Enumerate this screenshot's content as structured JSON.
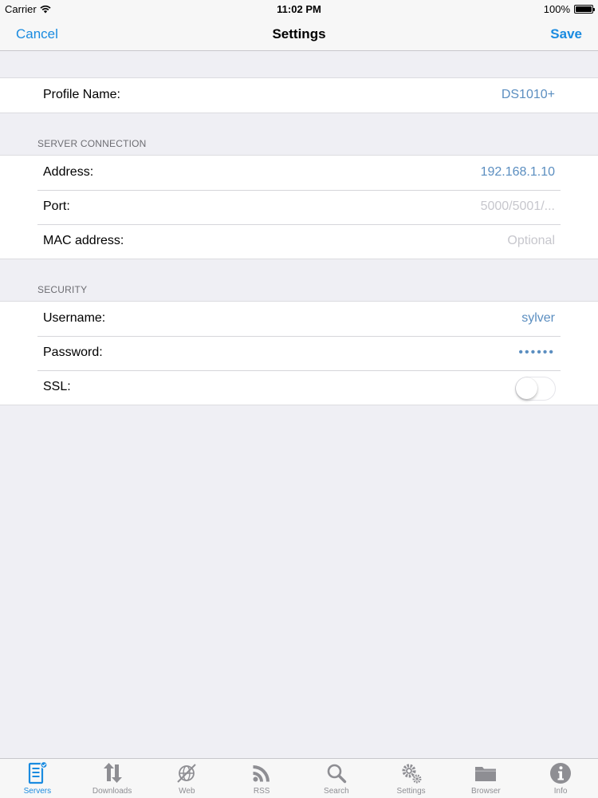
{
  "status_bar": {
    "carrier": "Carrier",
    "time": "11:02 PM",
    "battery": "100%"
  },
  "nav": {
    "cancel": "Cancel",
    "title": "Settings",
    "save": "Save"
  },
  "profile": {
    "label": "Profile Name:",
    "value": "DS1010+"
  },
  "server_connection": {
    "header": "SERVER CONNECTION",
    "address_label": "Address:",
    "address_value": "192.168.1.10",
    "port_label": "Port:",
    "port_placeholder": "5000/5001/...",
    "mac_label": "MAC address:",
    "mac_placeholder": "Optional"
  },
  "security": {
    "header": "SECURITY",
    "username_label": "Username:",
    "username_value": "sylver",
    "password_label": "Password:",
    "password_value": "••••••",
    "ssl_label": "SSL:",
    "ssl_on": false
  },
  "tabs": [
    {
      "label": "Servers",
      "icon": "servers-icon",
      "active": true
    },
    {
      "label": "Downloads",
      "icon": "downloads-icon"
    },
    {
      "label": "Web",
      "icon": "web-icon"
    },
    {
      "label": "RSS",
      "icon": "rss-icon"
    },
    {
      "label": "Search",
      "icon": "search-icon"
    },
    {
      "label": "Settings",
      "icon": "settings-icon"
    },
    {
      "label": "Browser",
      "icon": "folder-icon"
    },
    {
      "label": "Info",
      "icon": "info-icon"
    }
  ],
  "colors": {
    "accent": "#1a8be0",
    "value": "#5b8ec0",
    "background": "#efeff4"
  }
}
